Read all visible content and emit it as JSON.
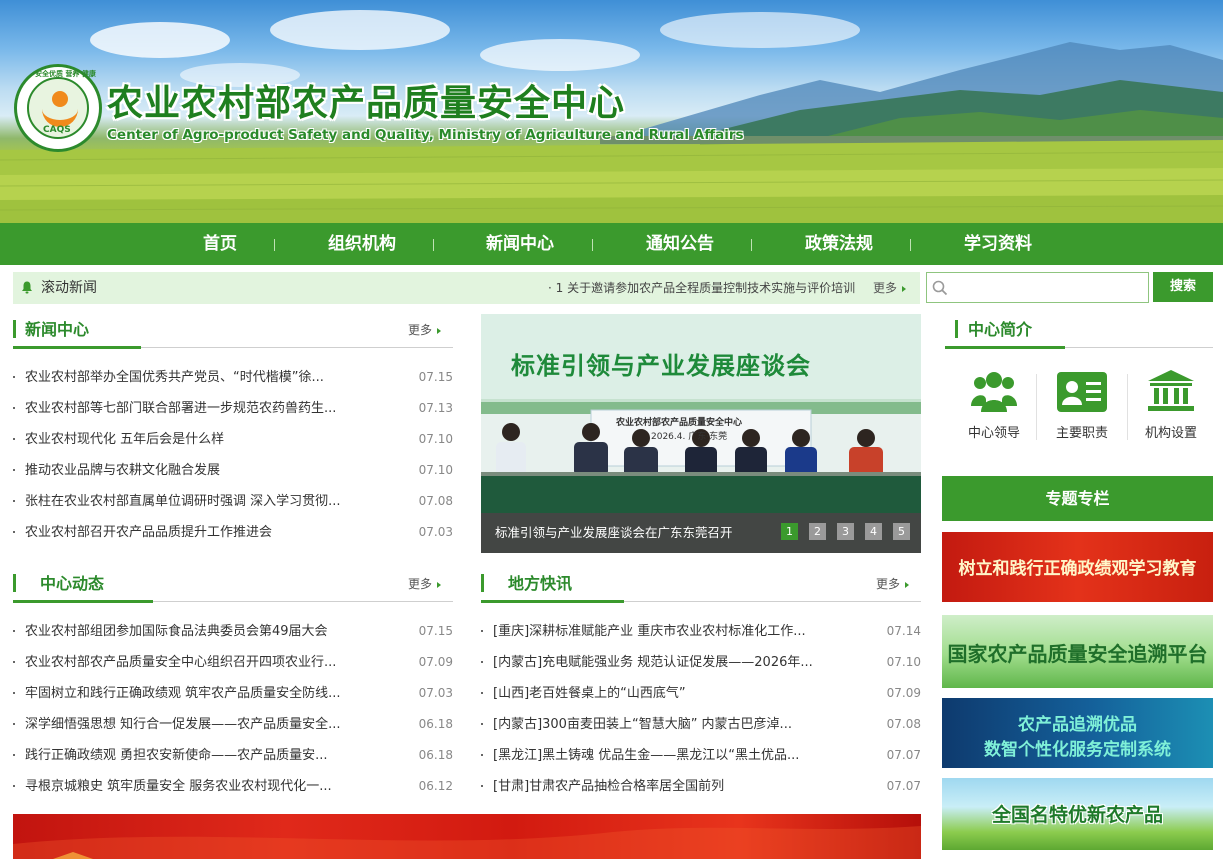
{
  "header": {
    "title": "农业农村部农产品质量安全中心",
    "subtitle": "Center of Agro-product Safety and Quality, Ministry of Agriculture and Rural Affairs",
    "logo_text": "CAQS",
    "logo_ring_text": "安全优质 营养 健康"
  },
  "nav": [
    {
      "label": "首页"
    },
    {
      "label": "组织机构"
    },
    {
      "label": "新闻中心"
    },
    {
      "label": "通知公告"
    },
    {
      "label": "政策法规"
    },
    {
      "label": "学习资料"
    }
  ],
  "ticker": {
    "label": "滚动新闻",
    "text": "· 1 关于邀请参加农产品全程质量控制技术实施与评价培训",
    "more": "更多"
  },
  "search": {
    "placeholder": "",
    "button": "搜索"
  },
  "news_center": {
    "title": "新闻中心",
    "more": "更多",
    "items": [
      {
        "text": "农业农村部举办全国优秀共产党员、“时代楷模”徐...",
        "date": "07.15"
      },
      {
        "text": "农业农村部等七部门联合部署进一步规范农药兽药生...",
        "date": "07.13"
      },
      {
        "text": "农业农村现代化 五年后会是什么样",
        "date": "07.10"
      },
      {
        "text": "推动农业品牌与农耕文化融合发展",
        "date": "07.10"
      },
      {
        "text": "张柱在农业农村部直属单位调研时强调 深入学习贯彻...",
        "date": "07.08"
      },
      {
        "text": "农业农村部召开农产品品质提升工作推进会",
        "date": "07.03"
      }
    ]
  },
  "slider": {
    "slide_title": "标准引领与产业发展座谈会",
    "slide_sub": "农业农村部农产品质量安全中心",
    "slide_date": "2026.4.  广东·东莞",
    "caption": "标准引领与产业发展座谈会在广东东莞召开",
    "pages": [
      "1",
      "2",
      "3",
      "4",
      "5"
    ]
  },
  "center_news": {
    "title": "中心动态",
    "more": "更多",
    "items": [
      {
        "text": "农业农村部组团参加国际食品法典委员会第49届大会",
        "date": "07.15"
      },
      {
        "text": "农业农村部农产品质量安全中心组织召开四项农业行...",
        "date": "07.09"
      },
      {
        "text": "牢固树立和践行正确政绩观 筑牢农产品质量安全防线...",
        "date": "07.03"
      },
      {
        "text": "深学细悟强思想 知行合一促发展——农产品质量安全...",
        "date": "06.18"
      },
      {
        "text": "践行正确政绩观 勇担农安新使命——农产品质量安...",
        "date": "06.18"
      },
      {
        "text": "寻根京城粮史 筑牢质量安全 服务农业农村现代化一...",
        "date": "06.12"
      }
    ]
  },
  "local_news": {
    "title": "地方快讯",
    "more": "更多",
    "items": [
      {
        "text": "[重庆]深耕标准赋能产业 重庆市农业农村标准化工作...",
        "date": "07.14"
      },
      {
        "text": "[内蒙古]充电赋能强业务 规范认证促发展——2026年...",
        "date": "07.10"
      },
      {
        "text": "[山西]老百姓餐桌上的“山西底气”",
        "date": "07.09"
      },
      {
        "text": "[内蒙古]300亩麦田装上“智慧大脑” 内蒙古巴彦淖...",
        "date": "07.08"
      },
      {
        "text": "[黑龙江]黑土铸魂 优品生金——黑龙江以“黑土优品...",
        "date": "07.07"
      },
      {
        "text": "[甘肃]甘肃农产品抽检合格率居全国前列",
        "date": "07.07"
      }
    ]
  },
  "intro": {
    "title": "中心简介",
    "items": [
      {
        "label": "中心领导",
        "icon": "people-icon"
      },
      {
        "label": "主要职责",
        "icon": "id-card-icon"
      },
      {
        "label": "机构设置",
        "icon": "institution-icon"
      }
    ]
  },
  "topics": {
    "title": "专题专栏",
    "banners": [
      {
        "text": "树立和践行正确政绩观学习教育"
      },
      {
        "text": "国家农产品质量安全追溯平台"
      },
      {
        "text_line1": "农产品追溯优品",
        "text_line2": "数智个性化服务定制系统"
      },
      {
        "text": "全国名特优新农产品"
      }
    ]
  },
  "colors": {
    "brand_green": "#3b9a2d",
    "title_green": "#1f7f1f",
    "ticker_bg": "#e2f4de",
    "promo_red": "#d62515"
  }
}
